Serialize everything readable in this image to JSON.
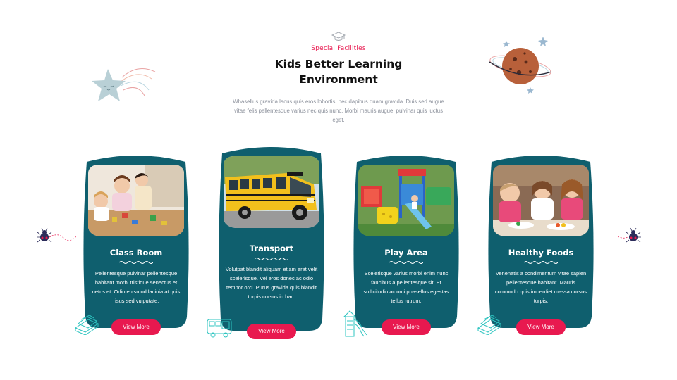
{
  "header": {
    "subtitle": "Special Facilities",
    "title": "Kids Better Learning Environment",
    "description": "Whasellus gravida lacus quis eros lobortis, nec dapibus quam gravida. Duis sed augue vitae felis pellentesque varius nec quis nunc. Morbi mauris augue, pulvinar quis luctus eget."
  },
  "cards": [
    {
      "title": "Class Room",
      "text": "Pellentesque pulvinar pellentesque habitant morbi tristique senectus et netus et. Odio euismod lacinia at quis risus sed vulputate.",
      "button": "View More",
      "side_icon": "books-icon"
    },
    {
      "title": "Transport",
      "text": "Volutpat blandit aliquam etiam erat velit scelerisque. Vel eros donec ac odio tempor orci. Purus gravida quis blandit turpis cursus in hac.",
      "button": "View More",
      "side_icon": "bus-icon"
    },
    {
      "title": "Play Area",
      "text": "Scelerisque varius morbi enim nunc faucibus a pellentesque sit. Et sollicitudin ac orci phasellus egestas tellus rutrum.",
      "button": "View More",
      "side_icon": "playground-icon"
    },
    {
      "title": "Healthy Foods",
      "text": "Venenatis a condimentum vitae sapien pellentesque habitant. Mauris commodo quis imperdiet massa cursus turpis.",
      "button": "View More",
      "side_icon": "books-icon"
    }
  ],
  "colors": {
    "card": "#0f5f6e",
    "accent": "#e8194f",
    "title": "#111111",
    "text": "#8a8f9a",
    "icon_line": "#2ec4c0"
  }
}
